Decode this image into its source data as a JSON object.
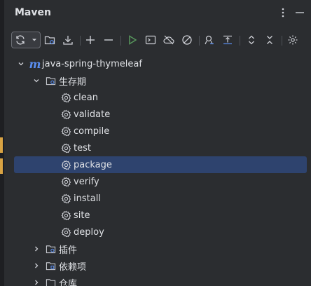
{
  "window": {
    "title": "Maven"
  },
  "header": {
    "more_icon": "more-vertical-icon",
    "hide_icon": "minimize-icon"
  },
  "toolbar": {
    "buttons": [
      {
        "name": "reload-icon"
      },
      {
        "name": "dropdown-arrow-icon"
      },
      {
        "name": "add-project-icon"
      },
      {
        "name": "download-icon"
      },
      {
        "name": "add-icon"
      },
      {
        "name": "remove-icon"
      },
      {
        "name": "run-icon"
      },
      {
        "name": "execute-goal-icon"
      },
      {
        "name": "offline-mode-icon"
      },
      {
        "name": "skip-tests-icon"
      },
      {
        "name": "show-dependencies-icon"
      },
      {
        "name": "collapse-icon"
      },
      {
        "name": "expand-all-icon"
      },
      {
        "name": "collapse-all-icon"
      },
      {
        "name": "settings-icon"
      }
    ]
  },
  "colors": {
    "accent": "#5a8ef0",
    "run_green": "#57965c",
    "selection": "#2e436e",
    "panel_bg": "#2b2d30"
  },
  "tree": {
    "project": {
      "label": "java-spring-thymeleaf",
      "icon": "m"
    },
    "lifecycle": {
      "label": "生存期",
      "items": [
        {
          "label": "clean"
        },
        {
          "label": "validate"
        },
        {
          "label": "compile"
        },
        {
          "label": "test"
        },
        {
          "label": "package",
          "selected": true
        },
        {
          "label": "verify"
        },
        {
          "label": "install"
        },
        {
          "label": "site"
        },
        {
          "label": "deploy"
        }
      ]
    },
    "plugins": {
      "label": "插件"
    },
    "dependencies": {
      "label": "依赖项"
    },
    "repositories": {
      "label": "仓库"
    }
  }
}
